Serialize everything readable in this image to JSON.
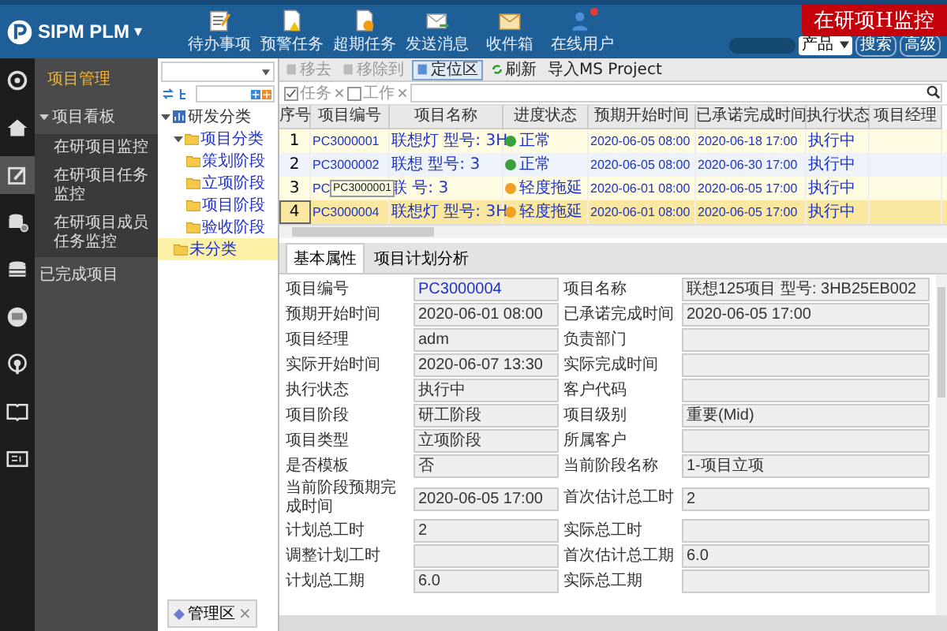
{
  "header": {
    "logo": "SIPM PLM",
    "logo_caret": "▾",
    "tools": [
      {
        "kind": "todo",
        "label": "待办事项"
      },
      {
        "kind": "warning",
        "label": "预警任务"
      },
      {
        "kind": "overdue",
        "label": "超期任务"
      },
      {
        "kind": "send",
        "label": "发送消息"
      },
      {
        "kind": "inbox",
        "label": "收件箱"
      },
      {
        "kind": "users",
        "label": "在线用户",
        "badge": true
      }
    ],
    "banner": "在研项H监控",
    "product": "产品",
    "buttons": [
      "搜索",
      "高级"
    ]
  },
  "rail": [
    {
      "kind": "radar",
      "selected": false
    },
    {
      "kind": "home",
      "selected": false
    },
    {
      "kind": "edit",
      "selected": true
    },
    {
      "kind": "dbgear",
      "selected": false
    },
    {
      "kind": "db",
      "selected": false
    },
    {
      "kind": "chat",
      "selected": false
    },
    {
      "kind": "signal",
      "selected": false
    },
    {
      "kind": "book",
      "selected": false
    },
    {
      "kind": "card",
      "selected": false
    }
  ],
  "menu": {
    "title": "项目管理",
    "items": [
      {
        "label": "项目看板",
        "expanded": true,
        "children": [
          {
            "label": "在研项目监控"
          },
          {
            "label": "在研项目任务监控"
          },
          {
            "label": "在研项目成员任务监控"
          }
        ]
      },
      {
        "label": "已完成项目"
      }
    ]
  },
  "tree": {
    "root": {
      "label": "研发分类",
      "expanded": true,
      "selected": false,
      "children": [
        {
          "label": "项目分类",
          "expanded": true,
          "selected": false,
          "children": [
            {
              "label": "策划阶段",
              "selected": false
            },
            {
              "label": "立项阶段",
              "selected": false
            },
            {
              "label": "项目阶段",
              "selected": false
            },
            {
              "label": "验收阶段",
              "selected": false
            }
          ]
        },
        {
          "label": "未分类",
          "selected": true
        }
      ]
    },
    "bottom_tab": "管理区",
    "bottom_tab_close": "×"
  },
  "toolbar": [
    "移去",
    "移除到",
    "定位区",
    "刷新",
    "导入MS Project"
  ],
  "filters": [
    {
      "label": "任务",
      "checked": true
    },
    {
      "label": "工作",
      "checked": false
    }
  ],
  "table": {
    "columns": [
      "序号",
      "项目编号",
      "项目名称",
      "进度状态",
      "预期开始时间",
      "已承诺完成时间",
      "执行状态",
      "项目经理"
    ],
    "rows": [
      {
        "no": "1",
        "code": "PC3000001",
        "name": "联想灯 型号: 3H",
        "status": "正常",
        "kind": "normal",
        "start": "2020-06-05 08:00",
        "due": "2020-06-18 17:00",
        "exec": "执行中",
        "selected": false
      },
      {
        "no": "2",
        "code": "PC3000002",
        "name": "联想 型号: 3",
        "status": "正常",
        "kind": "normal",
        "start": "2020-06-05 08:00",
        "due": "2020-06-30 17:00",
        "exec": "执行中",
        "selected": false
      },
      {
        "no": "3",
        "code": "PC",
        "name": "联 号: 3",
        "status": "轻度拖延",
        "kind": "delayed",
        "start": "2020-06-01 08:00",
        "due": "2020-06-05 17:00",
        "exec": "执行中",
        "selected": false,
        "tooltip": "PC3000001"
      },
      {
        "no": "4",
        "code": "PC3000004",
        "name": "联想灯 型号: 3H",
        "status": "轻度拖延",
        "kind": "delayed",
        "start": "2020-06-01 08:00",
        "due": "2020-06-05 17:00",
        "exec": "执行中",
        "selected": true
      }
    ]
  },
  "detail": {
    "tabs": [
      {
        "label": "基本属性",
        "selected": true
      },
      {
        "label": "项目计划分析",
        "selected": false
      }
    ],
    "fields": [
      {
        "label": "项目编号",
        "value": "PC3000004",
        "link": true
      },
      {
        "label": "项目名称",
        "value": "联想125项目 型号: 3HB25EB002"
      },
      {
        "label": "预期开始时间",
        "value": "2020-06-01 08:00"
      },
      {
        "label": "已承诺完成时间",
        "value": "2020-06-05 17:00"
      },
      {
        "label": "项目经理",
        "value": "adm"
      },
      {
        "label": "负责部门"
      },
      {
        "label": "实际开始时间",
        "value": "2020-06-07 13:30"
      },
      {
        "label": "实际完成时间"
      },
      {
        "label": "执行状态",
        "value": "执行中"
      },
      {
        "label": "客户代码"
      },
      {
        "label": "项目阶段",
        "value": "研工阶段"
      },
      {
        "label": "项目级别",
        "value": "重要(Mid)"
      },
      {
        "label": "项目类型",
        "value": "立项阶段"
      },
      {
        "label": "所属客户"
      },
      {
        "label": "是否模板",
        "value": "否"
      },
      {
        "label": "当前阶段名称",
        "value": "1-项目立项"
      },
      {
        "label": "当前阶段预期完成时间",
        "value": "2020-06-05 17:00"
      },
      {
        "label": "首次估计总工时",
        "value": "2"
      },
      {
        "label": "计划总工时",
        "value": "2"
      },
      {
        "label": "实际总工时"
      },
      {
        "label": "调整计划工时"
      },
      {
        "label": "首次估计总工期",
        "value": "6.0"
      },
      {
        "label": "计划总工期",
        "value": "6.0"
      },
      {
        "label": "实际总工期"
      }
    ]
  }
}
